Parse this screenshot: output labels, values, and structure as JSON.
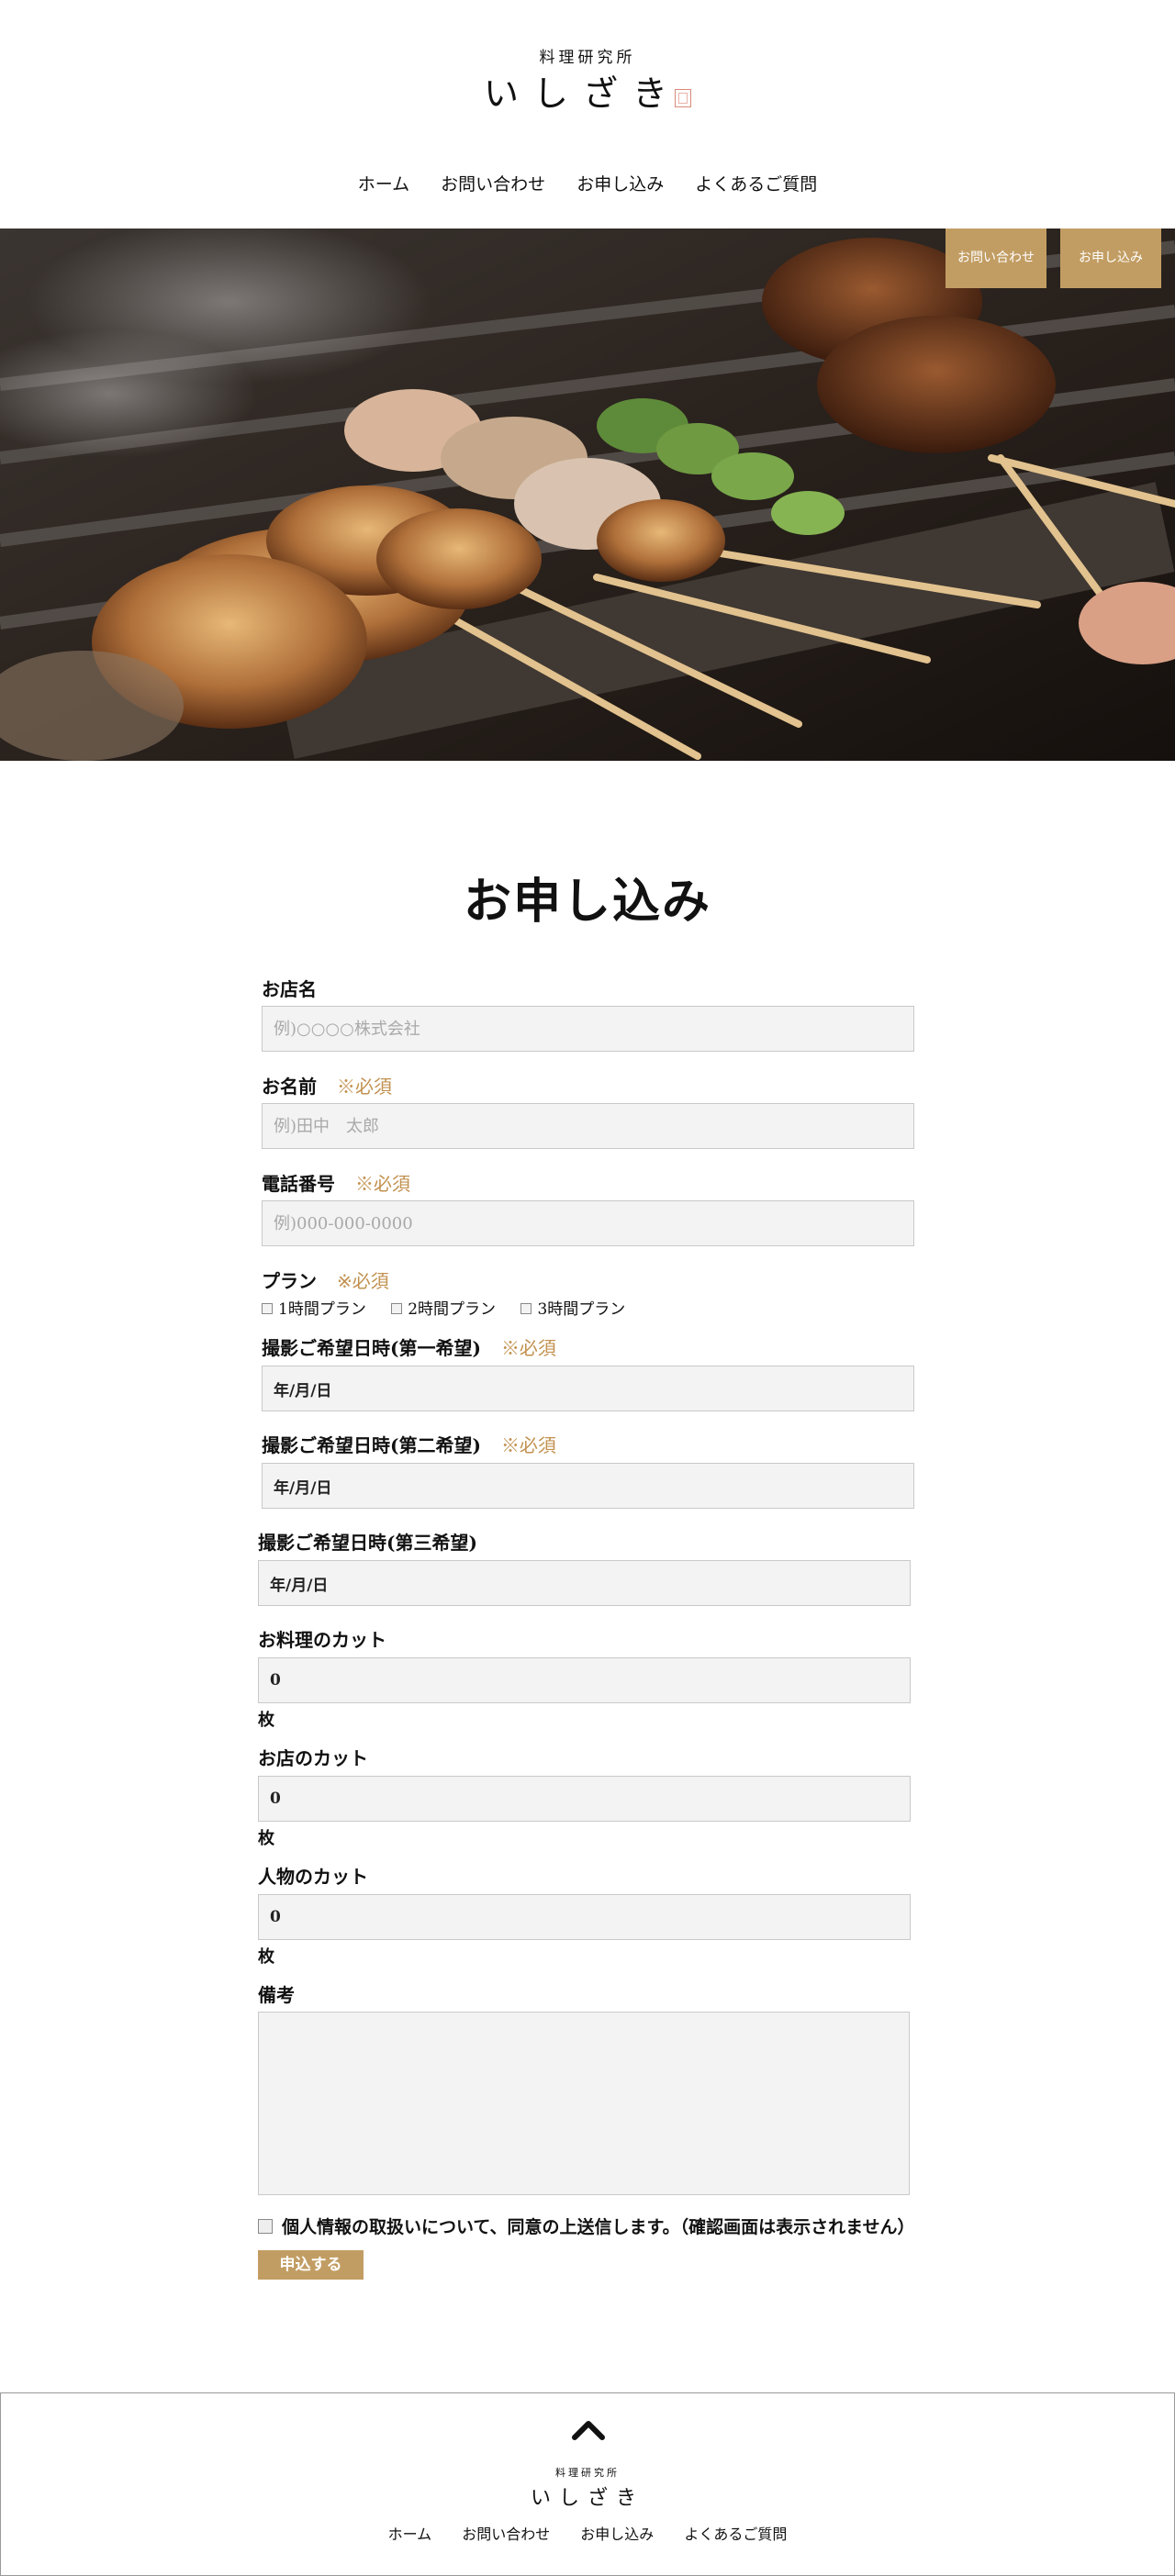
{
  "header": {
    "logo_sub": "料理研究所",
    "logo_main": "いしざき",
    "nav": [
      "ホーム",
      "お問い合わせ",
      "お申し込み",
      "よくあるご質問"
    ]
  },
  "hero": {
    "contact_button": "お問い合わせ",
    "apply_button": "お申し込み"
  },
  "form": {
    "title": "お申し込み",
    "required_mark": "※必須",
    "shop_name": {
      "label": "お店名",
      "placeholder": "例)○○○○株式会社"
    },
    "name": {
      "label": "お名前",
      "placeholder": "例)田中　太郎"
    },
    "phone": {
      "label": "電話番号",
      "placeholder": "例)000-000-0000"
    },
    "plan": {
      "label": "プラン",
      "options": [
        "1時間プラン",
        "2時間プラン",
        "3時間プラン"
      ]
    },
    "date1": {
      "label": "撮影ご希望日時(第一希望)",
      "value": "年/月/日"
    },
    "date2": {
      "label": "撮影ご希望日時(第二希望)",
      "value": "年/月/日"
    },
    "date3": {
      "label": "撮影ご希望日時(第三希望)",
      "value": "年/月/日"
    },
    "food_cut": {
      "label": "お料理のカット",
      "value": "0",
      "unit": "枚"
    },
    "shop_cut": {
      "label": "お店のカット",
      "value": "0",
      "unit": "枚"
    },
    "person_cut": {
      "label": "人物のカット",
      "value": "0",
      "unit": "枚"
    },
    "notes": {
      "label": "備考"
    },
    "consent": "個人情報の取扱いについて、同意の上送信します。（確認画面は表示されません）",
    "submit": "申込する"
  },
  "footer": {
    "logo_sub": "料理研究所",
    "logo_main": "いしざき",
    "nav": [
      "ホーム",
      "お問い合わせ",
      "お申し込み",
      "よくあるご質問"
    ]
  },
  "colors": {
    "accent": "#c29d63",
    "required": "#c2914f",
    "field_bg": "#f3f3f3"
  }
}
